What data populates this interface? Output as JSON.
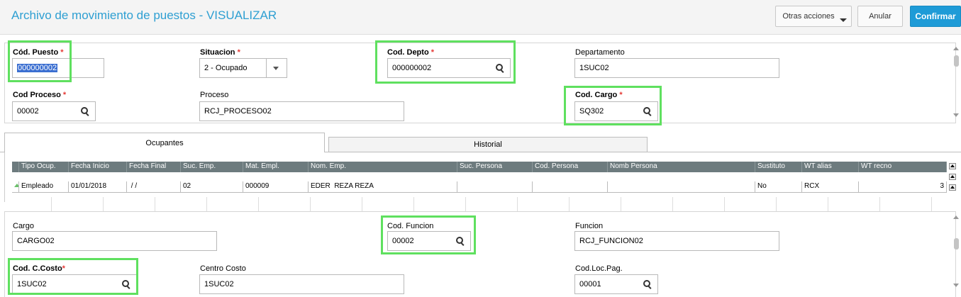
{
  "header": {
    "title": "Archivo de movimiento de puestos - VISUALIZAR",
    "otras_acciones": "Otras acciones",
    "anular": "Anular",
    "confirmar": "Confirmar"
  },
  "top_form": {
    "cod_puesto": {
      "label": "Cód. Puesto",
      "required": "*",
      "value": "000000002"
    },
    "situacion": {
      "label": "Situacion",
      "required": "*",
      "value": "2 - Ocupado"
    },
    "cod_depto": {
      "label": "Cod. Depto",
      "required": "*",
      "value": "000000002"
    },
    "departamento": {
      "label": "Departamento",
      "value": "1SUC02"
    },
    "cod_proceso": {
      "label": "Cod Proceso",
      "required": "*",
      "value": "00002"
    },
    "proceso": {
      "label": "Proceso",
      "value": "RCJ_PROCESO02"
    },
    "cod_cargo": {
      "label": "Cod. Cargo",
      "required": "*",
      "value": "SQ302"
    }
  },
  "tabs": {
    "ocupantes": "Ocupantes",
    "historial": "Historial"
  },
  "grid": {
    "columns": [
      "Tipo Ocup.",
      "Fecha Inicio",
      "Fecha Final",
      "Suc. Emp.",
      "Mat. Empl.",
      "Nom. Emp.",
      "Suc. Persona",
      "Cod. Persona",
      "Nomb Persona",
      "Sustituto",
      "WT alias",
      "WT recno"
    ],
    "rows": [
      [
        "Empleado",
        "01/01/2018",
        " / /",
        "02",
        "000009",
        "EDER  REZA REZA",
        "",
        "",
        "",
        "No",
        "RCX",
        "3"
      ]
    ]
  },
  "bottom_form": {
    "cargo": {
      "label": "Cargo",
      "value": "CARGO02"
    },
    "cod_funcion": {
      "label": "Cod. Funcion",
      "value": "00002"
    },
    "funcion": {
      "label": "Funcion",
      "value": "RCJ_FUNCION02"
    },
    "cod_ccosto": {
      "label": "Cod. C.Costo",
      "required": "*",
      "value": "1SUC02"
    },
    "centro_costo": {
      "label": "Centro Costo",
      "value": "1SUC02"
    },
    "cod_loc_pag": {
      "label": "Cod.Loc.Pag.",
      "value": "00001"
    }
  }
}
